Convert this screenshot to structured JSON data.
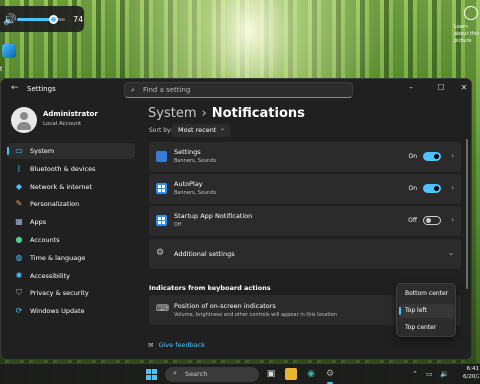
{
  "volume": {
    "value": "74",
    "level_percent": 74
  },
  "desktop": {
    "left_label": "t",
    "right_text": "Learn about this picture"
  },
  "window": {
    "title": "Settings",
    "search_placeholder": "Find a setting",
    "controls": [
      "–",
      "☐",
      "✕"
    ]
  },
  "profile": {
    "name": "Administrator",
    "role": "Local Account"
  },
  "sidebar": {
    "items": [
      {
        "label": "System",
        "icon": "monitor-icon",
        "active": true
      },
      {
        "label": "Bluetooth & devices",
        "icon": "bluetooth-icon"
      },
      {
        "label": "Network & internet",
        "icon": "wifi-icon"
      },
      {
        "label": "Personalization",
        "icon": "brush-icon"
      },
      {
        "label": "Apps",
        "icon": "apps-icon"
      },
      {
        "label": "Accounts",
        "icon": "person-icon"
      },
      {
        "label": "Time & language",
        "icon": "globe-clock-icon"
      },
      {
        "label": "Accessibility",
        "icon": "accessibility-icon"
      },
      {
        "label": "Privacy & security",
        "icon": "shield-icon"
      },
      {
        "label": "Windows Update",
        "icon": "update-icon"
      }
    ]
  },
  "main": {
    "breadcrumb_parent": "System",
    "breadcrumb_separator": "›",
    "breadcrumb_current": "Notifications",
    "sort_by_label": "Sort by:",
    "sort_value": "Most recent",
    "apps": [
      {
        "title": "Settings",
        "subtitle": "Banners, Sounds",
        "state": "On",
        "toggle": true
      },
      {
        "title": "AutoPlay",
        "subtitle": "Banners, Sounds",
        "state": "On",
        "toggle": true
      },
      {
        "title": "Startup App Notification",
        "subtitle": "Off",
        "state": "Off",
        "toggle": false
      }
    ],
    "additional_settings": "Additional settings",
    "section_heading": "Indicators from keyboard actions",
    "position_title": "Position of on-screen indicators",
    "position_desc": "Volume, brightness and other controls will appear in this location",
    "feedback": "Give feedback"
  },
  "dropdown": {
    "options": [
      "Bottom center",
      "Top left",
      "Top center"
    ],
    "selected": "Top left"
  },
  "taskbar": {
    "search": "Search",
    "clock_time": "6:41",
    "clock_date": "6/20/20"
  },
  "colors": {
    "accent": "#4cc2ff",
    "window_bg": "#202020",
    "card_bg": "#2b2b2b"
  }
}
